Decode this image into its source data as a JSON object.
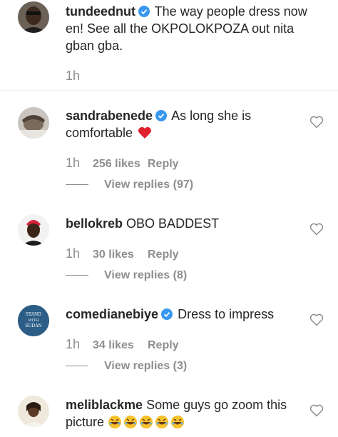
{
  "comments": [
    {
      "username": "tundeednut",
      "verified": true,
      "text": "The way people dress now en! See all the OKPOLOKPOZA out nita gban gba.",
      "time": "1h",
      "likes": "",
      "reply": "",
      "view_replies": ""
    },
    {
      "username": "sandrabenede",
      "verified": true,
      "text": "As long she is comfortable",
      "time": "1h",
      "likes": "256 likes",
      "reply": "Reply",
      "view_replies": "View replies (97)"
    },
    {
      "username": "bellokreb",
      "verified": false,
      "text": "OBO BADDEST",
      "time": "1h",
      "likes": "30 likes",
      "reply": "Reply",
      "view_replies": "View replies (8)"
    },
    {
      "username": "comedianebiye",
      "verified": true,
      "text": "Dress to impress",
      "time": "1h",
      "likes": "34 likes",
      "reply": "Reply",
      "view_replies": "View replies (3)",
      "avatar_text": [
        "STAND",
        "WITH",
        "SUDAN"
      ]
    },
    {
      "username": "meliblackme",
      "verified": false,
      "text": "Some guys go zoom this picture",
      "time": "",
      "likes": "",
      "reply": "",
      "view_replies": ""
    }
  ],
  "colors": {
    "text": "#262626",
    "muted": "#8e8e8e",
    "verified_blue": "#3897f0",
    "heart_red": "#ed4956",
    "avatar_sudan_bg": "#2b5d86"
  },
  "icons": {
    "verified": "verified-badge-icon",
    "like": "heart-outline-icon",
    "red_heart": "red-heart-emoji-icon",
    "laughing": "rolling-on-floor-laughing-emoji-icon"
  }
}
